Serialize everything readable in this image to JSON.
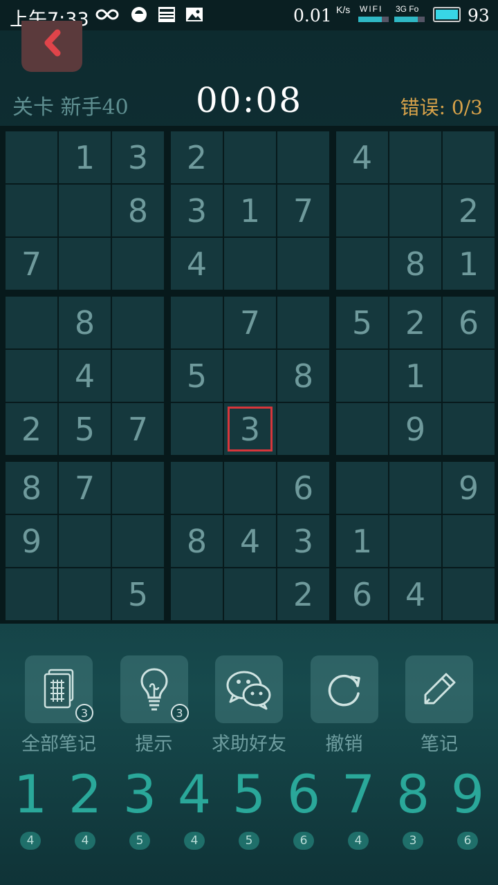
{
  "status_bar": {
    "time": "上午7:33",
    "net_speed": "0.01",
    "speed_unit": "K/s",
    "wifi_label": "WIFI",
    "net_label": "3G Fo",
    "battery": "93"
  },
  "header": {
    "level": "关卡 新手40",
    "timer": "00:08",
    "errors": "错误: 0/3"
  },
  "board": [
    [
      "",
      "1",
      "3",
      "2",
      "",
      "",
      "4",
      "",
      ""
    ],
    [
      "",
      "",
      "8",
      "3",
      "1",
      "7",
      "",
      "",
      "2"
    ],
    [
      "7",
      "",
      "",
      "4",
      "",
      "",
      "",
      "8",
      "1"
    ],
    [
      "",
      "8",
      "",
      "",
      "7",
      "",
      "5",
      "2",
      "6"
    ],
    [
      "",
      "4",
      "",
      "5",
      "",
      "8",
      "",
      "1",
      ""
    ],
    [
      "2",
      "5",
      "7",
      "",
      "3",
      "",
      "",
      "9",
      ""
    ],
    [
      "8",
      "7",
      "",
      "",
      "",
      "6",
      "",
      "",
      "9"
    ],
    [
      "9",
      "",
      "",
      "8",
      "4",
      "3",
      "1",
      "",
      ""
    ],
    [
      "",
      "",
      "5",
      "",
      "",
      "2",
      "6",
      "4",
      ""
    ]
  ],
  "selected_cell": {
    "row": 6,
    "col": 5
  },
  "tools": [
    {
      "label": "全部笔记",
      "icon": "notes-grid-icon",
      "badge": "3"
    },
    {
      "label": "提示",
      "icon": "lightbulb-icon",
      "badge": "3"
    },
    {
      "label": "求助好友",
      "icon": "wechat-icon",
      "badge": ""
    },
    {
      "label": "撤销",
      "icon": "undo-icon",
      "badge": ""
    },
    {
      "label": "笔记",
      "icon": "pencil-icon",
      "badge": ""
    }
  ],
  "numpad": [
    {
      "digit": "1",
      "count": "4"
    },
    {
      "digit": "2",
      "count": "4"
    },
    {
      "digit": "3",
      "count": "5"
    },
    {
      "digit": "4",
      "count": "4"
    },
    {
      "digit": "5",
      "count": "5"
    },
    {
      "digit": "6",
      "count": "6"
    },
    {
      "digit": "7",
      "count": "4"
    },
    {
      "digit": "8",
      "count": "3"
    },
    {
      "digit": "9",
      "count": "6"
    }
  ],
  "colors": {
    "background": "#10343a",
    "cell": "#15383d",
    "selected_outline": "#d8363b",
    "errors_text": "#d9a34a",
    "numpad_digit": "#2aa89a",
    "back_button": "#5b3a3c"
  }
}
